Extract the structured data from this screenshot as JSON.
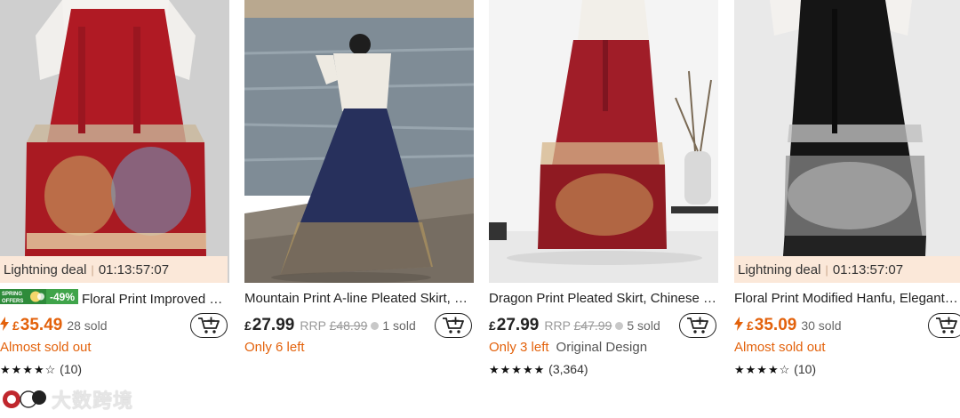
{
  "products": [
    {
      "deal_label": "Lightning deal",
      "timer": "01:13:57:07",
      "promo_line1": "SPRING",
      "promo_line2": "OFFERS",
      "discount": "-49%",
      "title": "Floral Print Improved Hanfu Skirt",
      "currency": "£",
      "price": "35.49",
      "rrp_label": "",
      "rrp_price": "",
      "sold": "28 sold",
      "stock": "Almost sold out",
      "extra": "",
      "stars": "★★★★☆",
      "reviews": "(10)"
    },
    {
      "deal_label": "",
      "timer": "",
      "title": "Mountain Print A-line Pleated Skirt, Chinese Style",
      "currency": "£",
      "price": "27.99",
      "rrp_label": "RRP",
      "rrp_price": "£48.99",
      "sold": "1 sold",
      "stock": "Only 6 left",
      "extra": "",
      "stars": "",
      "reviews": ""
    },
    {
      "deal_label": "",
      "timer": "",
      "title": "Dragon Print Pleated Skirt, Chinese Style Horse Face Skirt",
      "currency": "£",
      "price": "27.99",
      "rrp_label": "RRP",
      "rrp_price": "£47.99",
      "sold": "5 sold",
      "stock": "Only 3 left",
      "extra": "Original Design",
      "stars": "★★★★★",
      "reviews": "(3,364)"
    },
    {
      "deal_label": "Lightning deal",
      "timer": "01:13:57:07",
      "title": "Floral Print Modified Hanfu, Elegant Skirt",
      "currency": "£",
      "price": "35.09",
      "rrp_label": "",
      "rrp_price": "",
      "sold": "30 sold",
      "stock": "Almost sold out",
      "extra": "",
      "stars": "★★★★☆",
      "reviews": "(10)"
    }
  ],
  "watermark": "大数跨境",
  "colors": {
    "accent": "#e3620c",
    "deal_bg": "#fbe8d9",
    "promo_green": "#2e8b3a"
  }
}
